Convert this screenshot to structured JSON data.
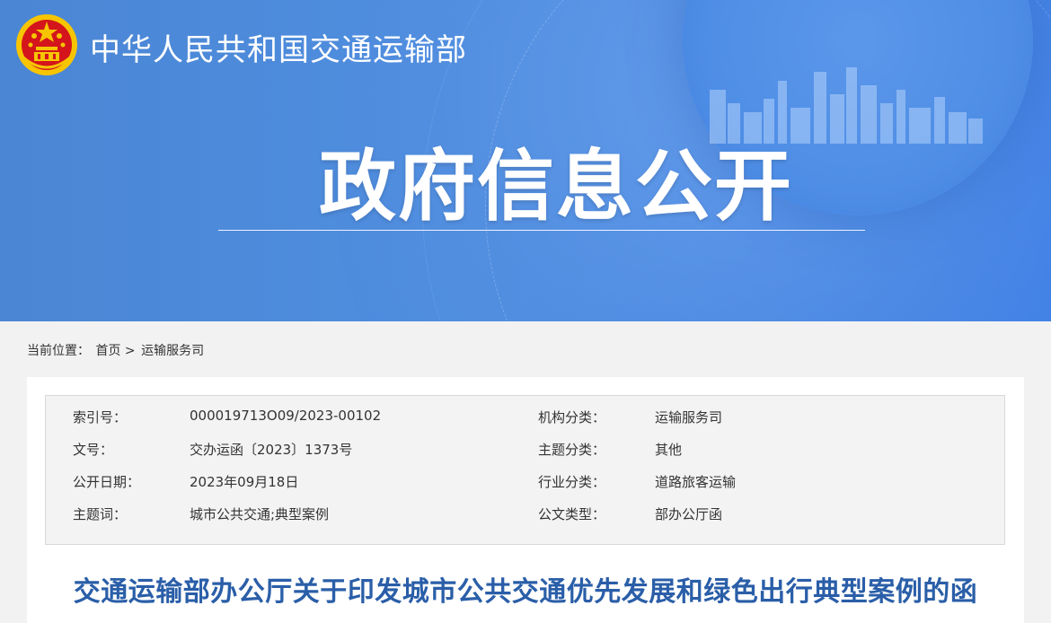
{
  "header": {
    "site_title": "中华人民共和国交通运输部",
    "section_title": "政府信息公开"
  },
  "breadcrumb": {
    "label": "当前位置：",
    "items": [
      "首页",
      "运输服务司"
    ],
    "separator": ">"
  },
  "meta": {
    "rows": [
      {
        "k1": "索引号：",
        "v1": "000019713O09/2023-00102",
        "k2": "机构分类：",
        "v2": "运输服务司"
      },
      {
        "k1": "文号：",
        "v1": "交办运函〔2023〕1373号",
        "k2": "主题分类：",
        "v2": "其他"
      },
      {
        "k1": "公开日期：",
        "v1": "2023年09月18日",
        "k2": "行业分类：",
        "v2": "道路旅客运输"
      },
      {
        "k1": "主题词：",
        "v1": "城市公共交通;典型案例",
        "k2": "公文类型：",
        "v2": "部办公厅函"
      }
    ]
  },
  "document": {
    "title": "交通运输部办公厅关于印发城市公共交通优先发展和绿色出行典型案例的函"
  },
  "colors": {
    "banner": "#4b86d4",
    "title_blue": "#2a5ea8",
    "emblem_red": "#d4151b",
    "emblem_gold": "#f7c500"
  },
  "icons": {
    "emblem": "national-emblem-icon"
  }
}
